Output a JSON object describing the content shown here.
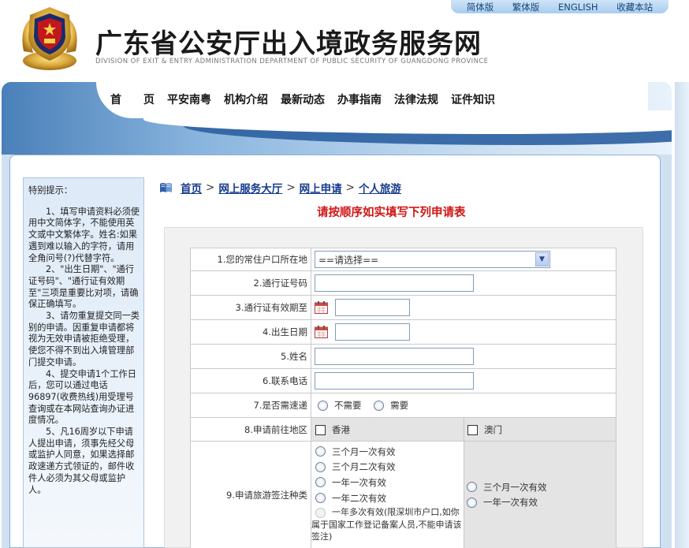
{
  "top_links": [
    "简体版",
    "繁体版",
    "ENGLISH",
    "收藏本站"
  ],
  "site": {
    "title": "广东省公安厅出入境政务服务网",
    "subtitle": "DIVISION OF EXIT & ENTRY ADMINISTRATION DEPARTMENT OF PUBLIC SECURITY OF GUANGDONG PROVINCE"
  },
  "nav": [
    "首　　页",
    "平安南粤",
    "机构介绍",
    "最新动态",
    "办事指南",
    "法律法规",
    "证件知识"
  ],
  "notice": {
    "heading": "特别提示：",
    "items": [
      "1、填写申请资料必须使用中文简体字，不能使用英文或中文繁体字。姓名:如果遇到难以输入的字符，请用全角问号(?)代替字符。",
      "2、\"出生日期\"、\"通行证号码\"、\"通行证有效期至\"三项是重要比对项，请确保正确填写。",
      "3、请勿重复提交同一类别的申请。因重复申请都将视为无效申请被拒绝受理，使您不得不到出入境管理部门提交申请。",
      "4、提交申请1个工作日后，您可以通过电话96897(收费热线)用受理号查询或在本网站查询办证进度情况。",
      "5、凡16周岁以下申请人提出申请，须事先经父母或监护人同意，如果选择邮政速递方式领证的，邮件收件人必须为其父母或监护人。"
    ]
  },
  "breadcrumb": {
    "items": [
      "首页",
      "网上服务大厅",
      "网上申请",
      "个人旅游"
    ],
    "separator": ">"
  },
  "form_title": "请按顺序如实填写下列申请表",
  "form": {
    "residence": {
      "label": "1.您的常住户口所在地",
      "value": "==请选择=="
    },
    "permit_no": {
      "label": "2.通行证号码",
      "value": ""
    },
    "permit_expiry": {
      "label": "3.通行证有效期至",
      "value": ""
    },
    "birth_date": {
      "label": "4.出生日期",
      "value": ""
    },
    "name": {
      "label": "5.姓名",
      "value": ""
    },
    "phone": {
      "label": "6.联系电话",
      "value": ""
    },
    "express": {
      "label": "7.是否需速递",
      "options": [
        "不需要",
        "需要"
      ]
    },
    "region": {
      "label": "8.申请前往地区",
      "options": [
        "香港",
        "澳门"
      ]
    },
    "visa_type": {
      "label": "9.申请旅游签注种类",
      "hk_options": [
        "三个月一次有效",
        "三个月二次有效",
        "一年一次有效",
        "一年二次有效"
      ],
      "hk_note": "一年多次有效(限深圳市户口,如你属于国家工作登记备案人员,不能申请该签注)",
      "macau_options": [
        "三个月一次有效",
        "一年一次有效"
      ]
    }
  },
  "colors": {
    "nav_blue": "#2b5fa1",
    "title_red": "#d01515",
    "link_blue": "#153a8c"
  }
}
